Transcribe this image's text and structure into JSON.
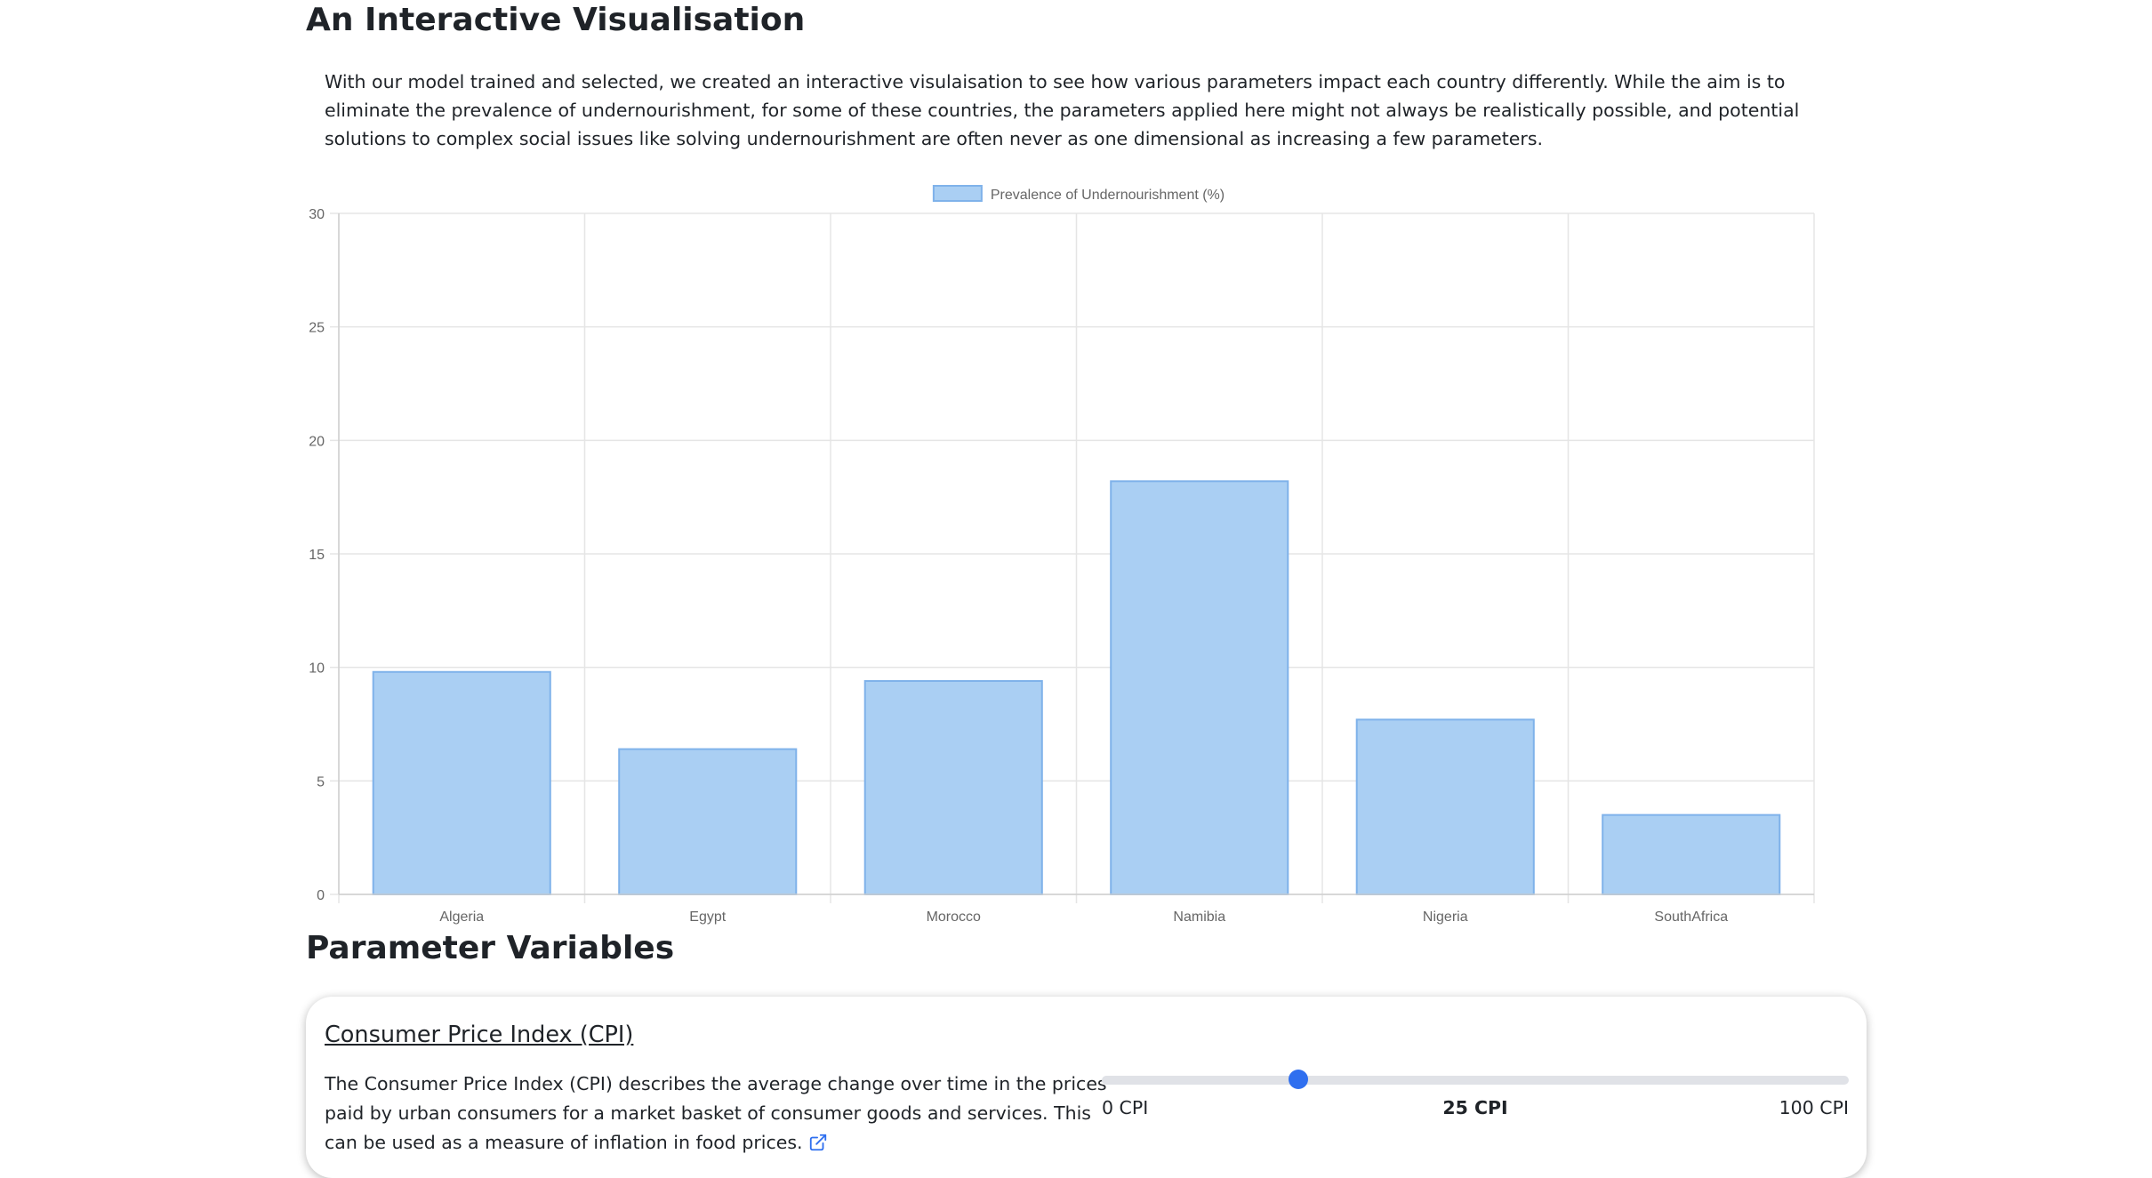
{
  "visualisation": {
    "title": "An Interactive Visualisation",
    "intro": "With our model trained and selected, we created an interactive visulaisation to see how various parameters impact each country differently. While the aim is to eliminate the prevalence of undernourishment, for some of these countries, the parameters applied here might not always be realistically possible, and potential solutions to complex social issues like solving undernourishment are often never as one dimensional as increasing a few parameters."
  },
  "chart_data": {
    "type": "bar",
    "categories": [
      "Algeria",
      "Egypt",
      "Morocco",
      "Namibia",
      "Nigeria",
      "SouthAfrica"
    ],
    "series": [
      {
        "name": "Prevalence of Undernourishment (%)",
        "values": [
          9.8,
          6.4,
          9.4,
          18.2,
          7.7,
          3.5
        ]
      }
    ],
    "ylim": [
      0,
      30
    ],
    "yticks": [
      0,
      5,
      10,
      15,
      20,
      25,
      30
    ],
    "grid": true,
    "legend": "top-center",
    "colors": {
      "fill": "#aacff3",
      "stroke": "#7fb2ea",
      "grid": "#e5e5e5",
      "axis_text": "#666666"
    }
  },
  "parameters": {
    "title": "Parameter Variables",
    "cpi": {
      "name": "Consumer Price Index (CPI)",
      "description": "The Consumer Price Index (CPI) describes the average change over time in the prices paid by urban consumers for a market basket of consumer goods and services. This can be used as a measure of inflation in food prices.",
      "link_icon": "external-link-icon",
      "min": 0,
      "max": 100,
      "value": 25,
      "min_label": "0 CPI",
      "value_label": "25 CPI",
      "max_label": "100 CPI",
      "accent": "#2f6fef"
    }
  }
}
